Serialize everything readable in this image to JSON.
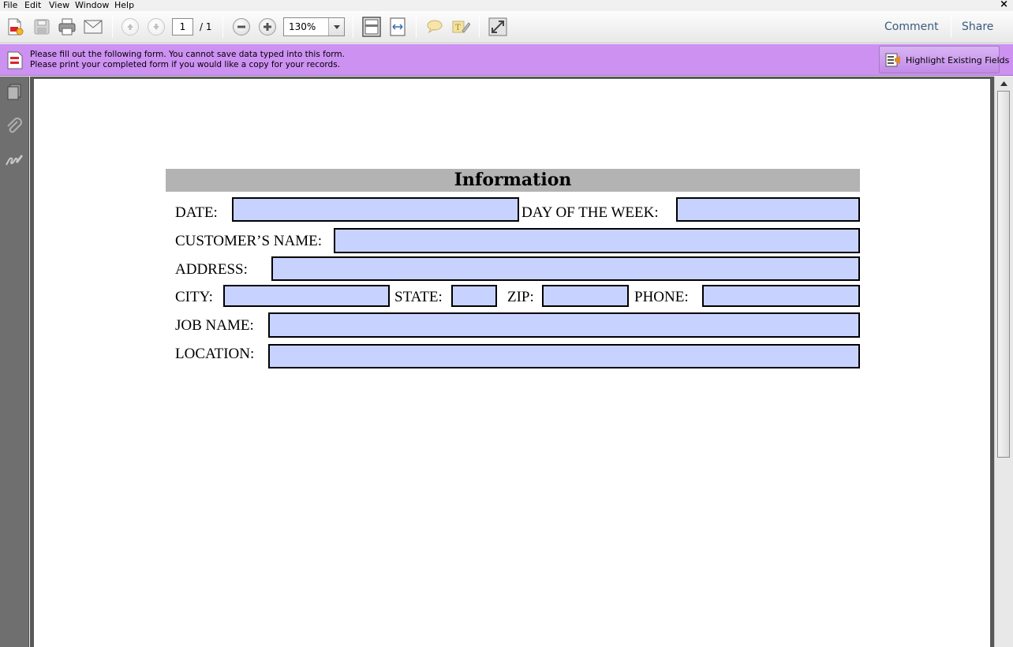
{
  "menu": {
    "items": [
      "File",
      "Edit",
      "View",
      "Window",
      "Help"
    ],
    "close_symbol": "×"
  },
  "toolbar": {
    "page_current": "1",
    "page_total": "/ 1",
    "zoom": "130%",
    "comment_label": "Comment",
    "share_label": "Share",
    "icons": [
      "create-pdf-icon",
      "save-icon",
      "print-icon",
      "email-icon",
      "previous-page-icon",
      "next-page-icon",
      "zoom-out-icon",
      "zoom-in-icon",
      "fit-page-icon",
      "fit-width-icon",
      "sticky-note-icon",
      "highlight-text-icon",
      "full-screen-icon"
    ]
  },
  "notice": {
    "line1": "Please fill out the following form. You cannot save data typed into this form.",
    "line2": "Please print your completed form if you would like a copy for your records.",
    "button_label": "Highlight Existing Fields",
    "background": "#cd91f2"
  },
  "leftpane": {
    "icons": [
      "pages-icon",
      "attachments-icon",
      "signatures-icon"
    ]
  },
  "form": {
    "title": "Information",
    "field_color": "#c8d2ff",
    "header_color": "#b3b3b3",
    "labels": {
      "date": "DATE:",
      "day_of_week": "DAY OF THE WEEK:",
      "customer_name": "CUSTOMER’S NAME:",
      "address": "ADDRESS:",
      "city": "CITY:",
      "state": "STATE:",
      "zip": "ZIP:",
      "phone": "PHONE:",
      "job_name": "JOB NAME:",
      "location": "LOCATION:"
    },
    "values": {
      "date": "",
      "day_of_week": "",
      "customer_name": "",
      "address": "",
      "city": "",
      "state": "",
      "zip": "",
      "phone": "",
      "job_name": "",
      "location": ""
    }
  }
}
